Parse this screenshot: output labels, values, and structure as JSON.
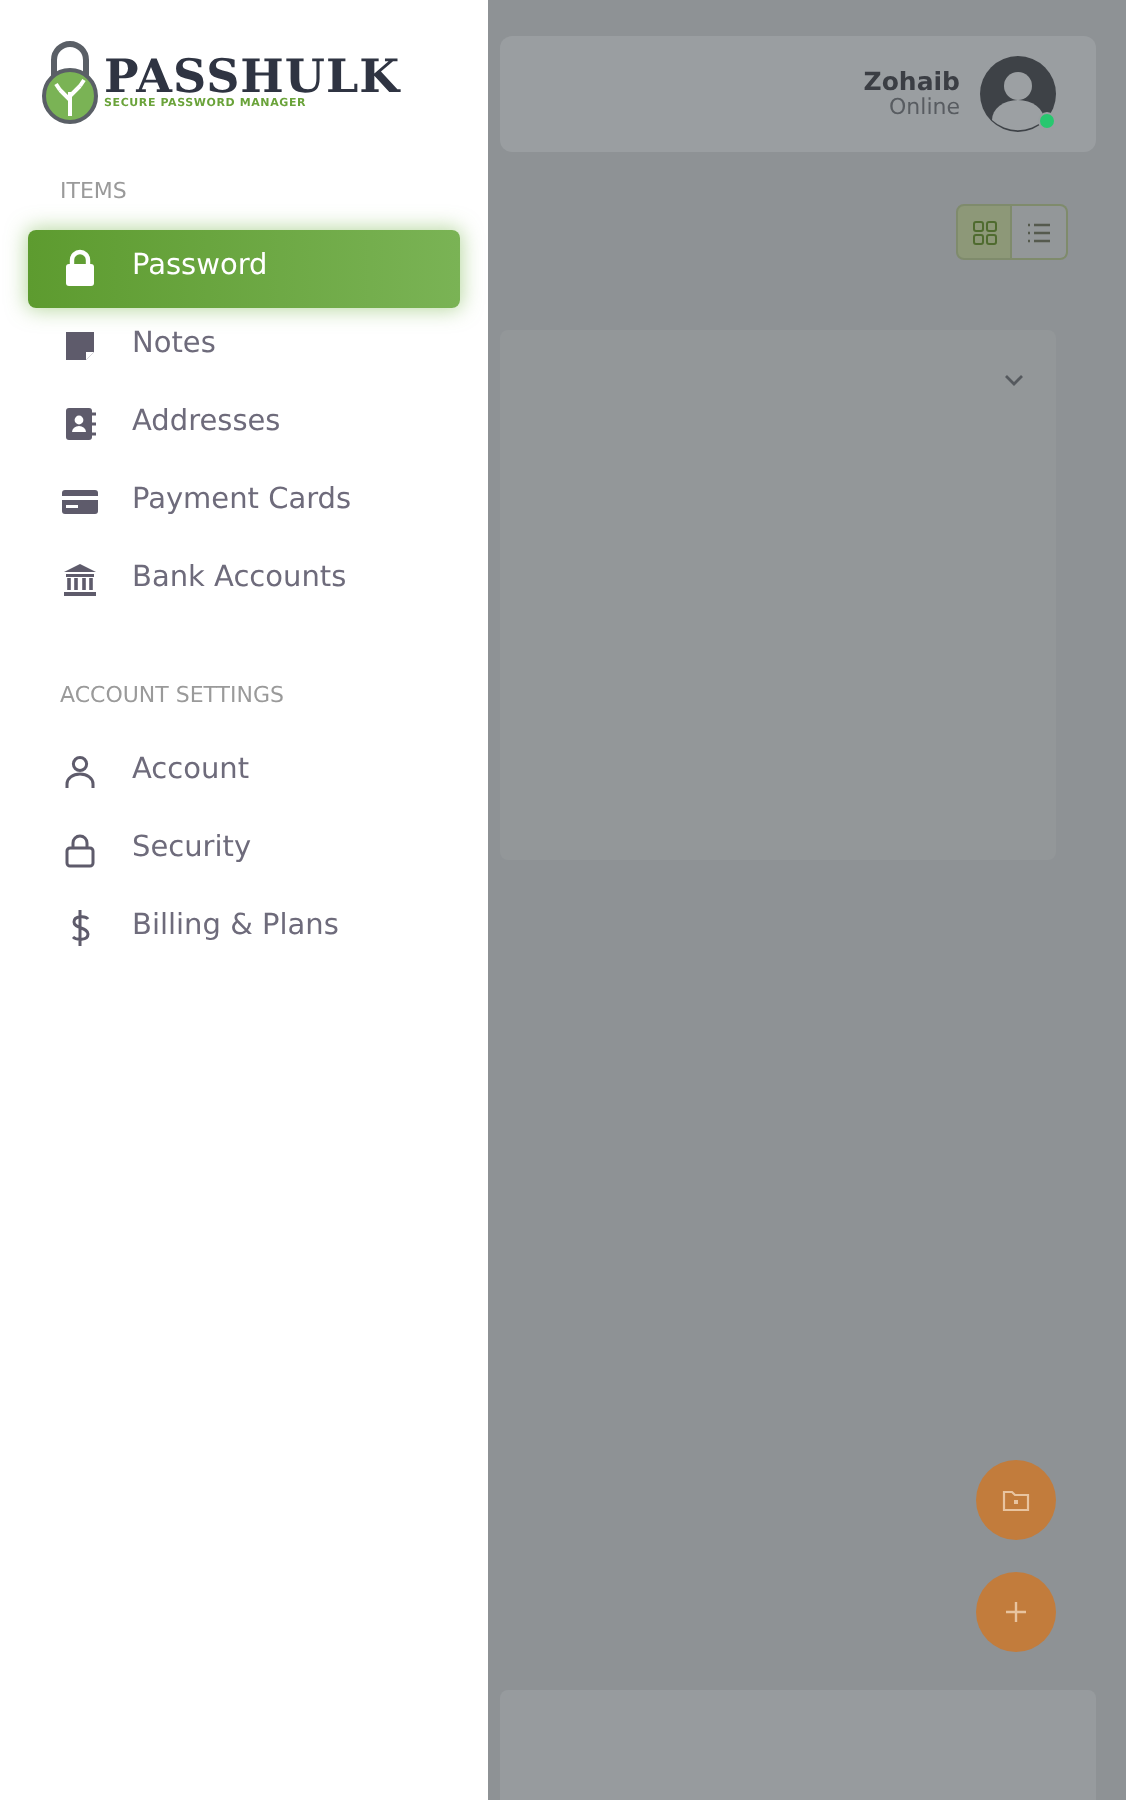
{
  "logo": {
    "name": "PASSHULK",
    "tagline": "SECURE PASSWORD MANAGER"
  },
  "sidebar": {
    "sections": [
      {
        "title": "ITEMS",
        "items": [
          {
            "label": "Password",
            "selected": true
          },
          {
            "label": "Notes",
            "selected": false
          },
          {
            "label": "Addresses",
            "selected": false
          },
          {
            "label": "Payment Cards",
            "selected": false
          },
          {
            "label": "Bank Accounts",
            "selected": false
          }
        ]
      },
      {
        "title": "ACCOUNT SETTINGS",
        "items": [
          {
            "label": "Account",
            "selected": false
          },
          {
            "label": "Security",
            "selected": false
          },
          {
            "label": "Billing & Plans",
            "selected": false
          }
        ]
      }
    ]
  },
  "header": {
    "user": {
      "name": "Zohaib",
      "status": "Online",
      "online": true
    }
  },
  "view_toggle": [
    {
      "kind": "grid",
      "selected": true
    },
    {
      "kind": "list",
      "selected": false
    }
  ],
  "fabs": [
    {
      "kind": "folder"
    },
    {
      "kind": "add"
    }
  ]
}
